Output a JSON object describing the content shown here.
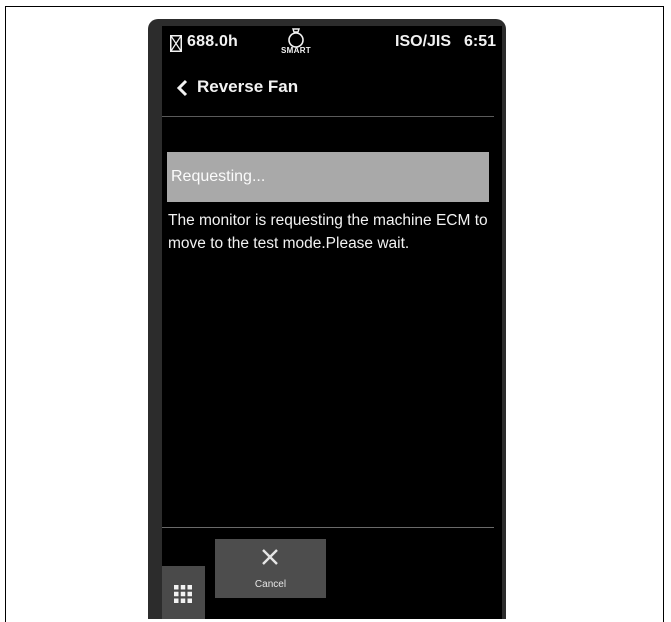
{
  "status_bar": {
    "icons": {
      "hours": "hourglass-icon",
      "smart": "smart-mode-icon"
    },
    "hours": "688.0h",
    "smart_label": "SMART",
    "standard": "ISO/JIS",
    "time": "6:51"
  },
  "header": {
    "back_icon": "chevron-left-icon",
    "title": "Reverse Fan"
  },
  "main": {
    "status_text": "Requesting...",
    "message": "The monitor is requesting the machine ECM to move to the test mode.Please wait."
  },
  "footer": {
    "apps_icon": "grid-menu-icon",
    "cancel_icon": "close-icon",
    "cancel_label": "Cancel"
  },
  "colors": {
    "screen_background": "#000000",
    "banner": "#a9a9a9",
    "button": "#4d4d4d",
    "text": "#f2f2f2"
  }
}
